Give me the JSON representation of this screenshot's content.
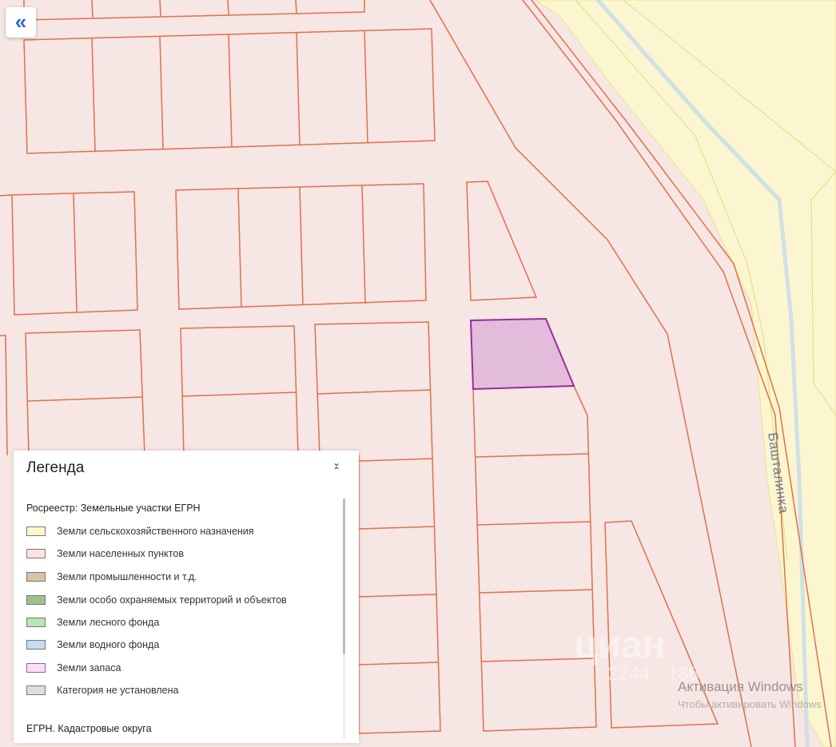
{
  "map": {
    "collapse_label": "«",
    "river_label": "Башталинка",
    "watermark_logo": "циан",
    "watermark_id": "2244 · 186",
    "colors": {
      "background": "#f6e6e4",
      "parcel_border": "#e0704a",
      "selected_fill": "#e3bcdc",
      "selected_border": "#9b2a9e",
      "agri_fill": "#fbf6cf",
      "agri_border": "#ebe48a",
      "river": "#cfe0e6"
    }
  },
  "legend": {
    "title": "Легенда",
    "toggle_icon": "chevron-collapse-icon",
    "section1": "Росреестр: Земельные участки ЕГРН",
    "items": [
      {
        "label": "Земли сельскохозяйственного назначения",
        "color": "#fdf8c8"
      },
      {
        "label": "Земли населенных пунктов",
        "color": "#fbe3df"
      },
      {
        "label": "Земли промышленности и т.д.",
        "color": "#d7c3a6"
      },
      {
        "label": "Земли особо охраняемых территорий и объектов",
        "color": "#9dc08a"
      },
      {
        "label": "Земли лесного фонда",
        "color": "#b9e3b8"
      },
      {
        "label": "Земли водного фонда",
        "color": "#c5dcf5"
      },
      {
        "label": "Земли запаса",
        "color": "#fbdcfb"
      },
      {
        "label": "Категория не установлена",
        "color": "#dedede"
      }
    ],
    "section2": "ЕГРН. Кадастровые округа"
  },
  "windows_activation": {
    "title": "Активация Windows",
    "subtitle": "Чтобы активировать Windows"
  }
}
